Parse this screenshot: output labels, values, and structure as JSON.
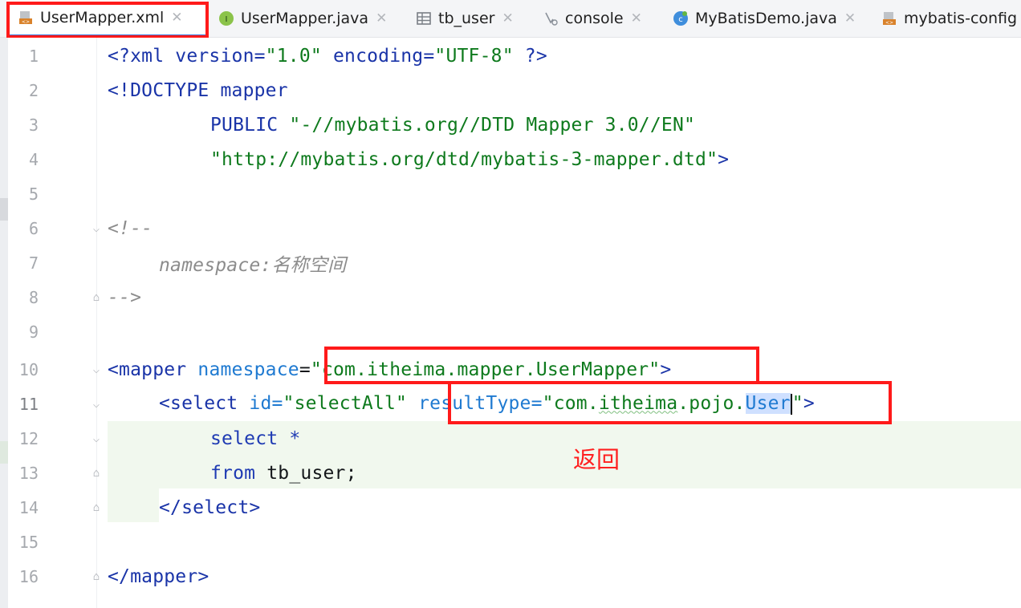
{
  "tabs": [
    {
      "label": "UserMapper.xml",
      "icon": "xml-file-icon",
      "active": true
    },
    {
      "label": "UserMapper.java",
      "icon": "interface-icon",
      "active": false
    },
    {
      "label": "tb_user",
      "icon": "table-icon",
      "active": false
    },
    {
      "label": "console",
      "icon": "console-icon",
      "active": false
    },
    {
      "label": "MyBatisDemo.java",
      "icon": "class-icon",
      "active": false
    },
    {
      "label": "mybatis-config",
      "icon": "xml-file-icon",
      "active": false
    }
  ],
  "editor": {
    "line_numbers": [
      "1",
      "2",
      "3",
      "4",
      "5",
      "6",
      "7",
      "8",
      "9",
      "10",
      "11",
      "12",
      "13",
      "14",
      "15",
      "16"
    ],
    "lines": {
      "l1": {
        "a": "<?xml version=",
        "b": "\"1.0\"",
        "c": " encoding=",
        "d": "\"UTF-8\"",
        "e": " ?>"
      },
      "l2": {
        "a": "<!DOCTYPE mapper"
      },
      "l3": {
        "a": "PUBLIC ",
        "b": "\"-//mybatis.org//DTD Mapper 3.0//EN\""
      },
      "l4": {
        "a": "\"http://mybatis.org/dtd/mybatis-3-mapper.dtd\"",
        "b": ">"
      },
      "l6": {
        "a": "<!--"
      },
      "l7": {
        "a": "namespace:名称空间"
      },
      "l8": {
        "a": "-->"
      },
      "l10": {
        "a": "<mapper",
        "b": " namespace",
        "c": "=",
        "d": "\"com.itheima.mapper.UserMapper\"",
        "e": ">"
      },
      "l11": {
        "a": "<select",
        "b": " id=",
        "c": "\"selectAll\"",
        "d": " resultType=",
        "e": "\"com.",
        "f": "itheima",
        "g": ".pojo.",
        "h": "U",
        "i": "ser",
        "j": "\"",
        "k": ">"
      },
      "l12": {
        "a": "select *"
      },
      "l13": {
        "a": "from",
        "b": " tb_user;"
      },
      "l14": {
        "a": "</select>"
      },
      "l16": {
        "a": "</mapper>"
      }
    }
  },
  "annotation": {
    "text": "返回"
  },
  "colors": {
    "highlight_box": "#ff1a1a",
    "annotation": "#ff1f1f"
  }
}
